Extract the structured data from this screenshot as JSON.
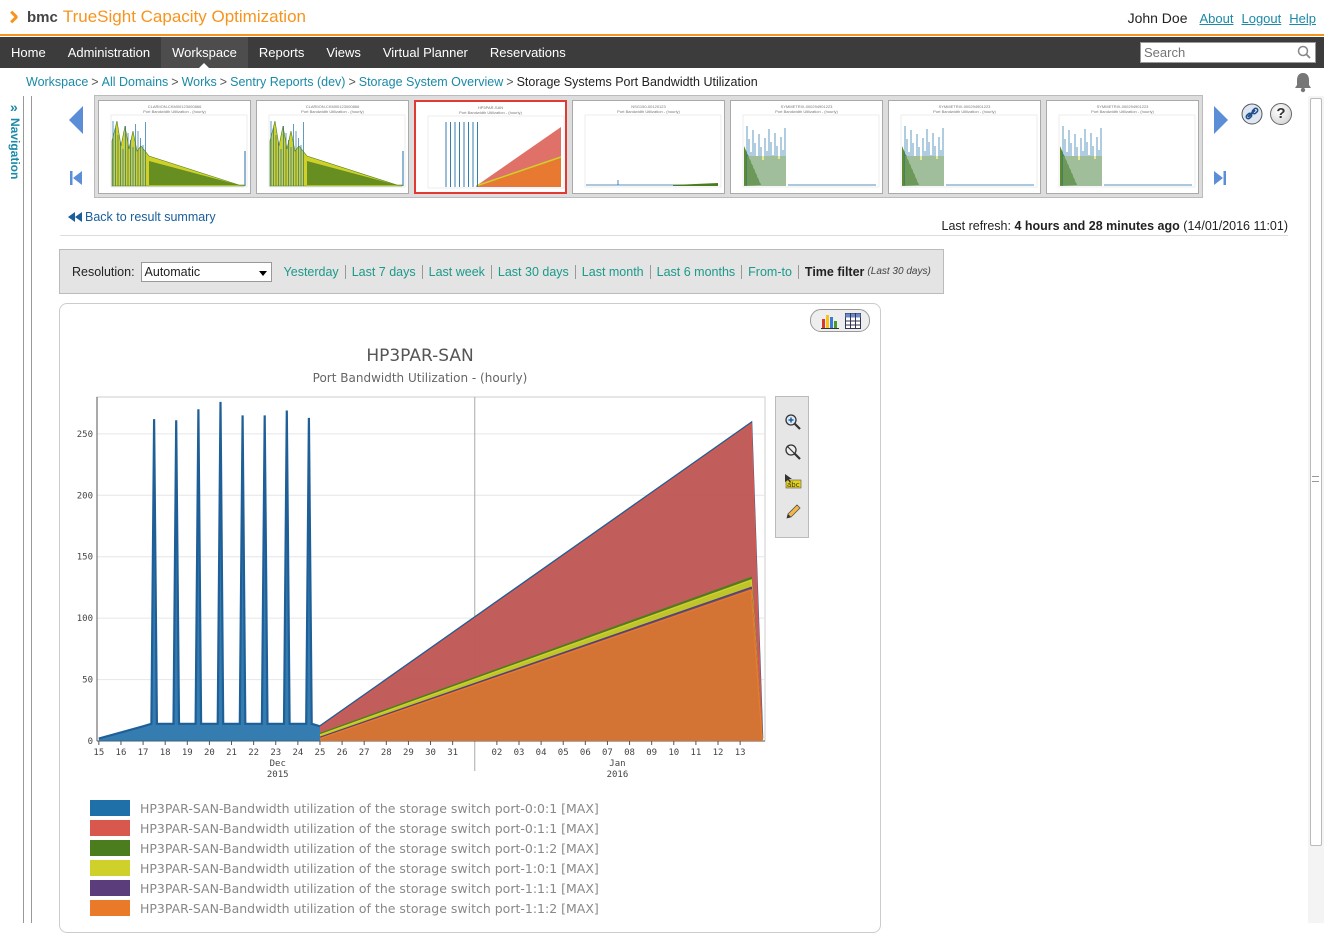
{
  "header": {
    "brand": "bmc",
    "product": "TrueSight Capacity Optimization",
    "user_name": "John Doe",
    "links": [
      "About",
      "Logout",
      "Help"
    ]
  },
  "menu": {
    "items": [
      "Home",
      "Administration",
      "Workspace",
      "Reports",
      "Views",
      "Virtual Planner",
      "Reservations"
    ],
    "active": "Workspace",
    "search_placeholder": "Search"
  },
  "breadcrumb": {
    "items": [
      "Workspace",
      "All Domains",
      "Works",
      "Sentry Reports (dev)",
      "Storage System Overview"
    ],
    "current": "Storage Systems Port Bandwidth Utilization"
  },
  "nav": {
    "label": "Navigation",
    "chevron": "»"
  },
  "carousel": {
    "selected_index": 2,
    "thumb_titles": [
      "CLARIION-CKM00123000866",
      "CLARIION-CKM00123000866",
      "HP3PAR-SAN",
      "NSG150-00120123",
      "SYMMETRIX-000294901223",
      "SYMMETRIX-000294901223",
      "SYMMETRIX-000294901223"
    ],
    "thumb_subtitle": "Port Bandwidth Utilization - (hourly)"
  },
  "back_link": "Back to result summary",
  "refresh": {
    "label": "Last refresh:",
    "ago": "4 hours and 28 minutes ago",
    "stamp": "(14/01/2016 11:01)"
  },
  "filter": {
    "resolution_label": "Resolution:",
    "resolution_value": "Automatic",
    "options": [
      "Yesterday",
      "Last 7 days",
      "Last week",
      "Last 30 days",
      "Last month",
      "Last 6 months",
      "From-to"
    ],
    "time_filter_label": "Time filter",
    "time_filter_value": "(Last 30 days)"
  },
  "colors": {
    "accent": "#f7941d",
    "link": "#1a8aa8",
    "selected_border": "#e03a32"
  },
  "chart_data": {
    "type": "area",
    "title": "HP3PAR-SAN",
    "subtitle": "Port Bandwidth Utilization - (hourly)",
    "ylim": [
      0,
      280
    ],
    "yticks": [
      0,
      50,
      100,
      150,
      200,
      250
    ],
    "x_day_ticks": [
      "15",
      "16",
      "17",
      "18",
      "19",
      "20",
      "21",
      "22",
      "23",
      "24",
      "25",
      "26",
      "27",
      "28",
      "29",
      "30",
      "31",
      "02",
      "03",
      "04",
      "05",
      "06",
      "07",
      "08",
      "09",
      "10",
      "11",
      "12",
      "13"
    ],
    "x_month_labels": [
      {
        "month": "Dec",
        "year": "2015"
      },
      {
        "month": "Jan",
        "year": "2016"
      }
    ],
    "grid": true,
    "legend_position": "bottom",
    "series": [
      {
        "name": "HP3PAR-SAN-Bandwidth utilization of the storage switch port-0:0:1 [MAX]",
        "color": "#1f6fa8",
        "points": [
          [
            "2015-12-15",
            2
          ],
          [
            "2015-12-16",
            7
          ],
          [
            "2015-12-17",
            12
          ],
          [
            "2015-12-17 12:00",
            262
          ],
          [
            "2015-12-18 12:00",
            261
          ],
          [
            "2015-12-19 12:00",
            270
          ],
          [
            "2015-12-20 12:00",
            276
          ],
          [
            "2015-12-21 12:00",
            265
          ],
          [
            "2015-12-22 12:00",
            265
          ],
          [
            "2015-12-23 12:00",
            269
          ],
          [
            "2015-12-24 12:00",
            263
          ],
          [
            "2015-12-25",
            12
          ],
          [
            "2016-01-13 12:00",
            259
          ],
          [
            "2016-01-14",
            2
          ]
        ]
      },
      {
        "name": "HP3PAR-SAN-Bandwidth utilization of the storage switch port-0:1:1 [MAX]",
        "color": "#d9584d",
        "points": [
          [
            "2015-12-25",
            11
          ],
          [
            "2016-01-13 12:00",
            258
          ],
          [
            "2016-01-14",
            1
          ]
        ]
      },
      {
        "name": "HP3PAR-SAN-Bandwidth utilization of the storage switch port-0:1:2 [MAX]",
        "color": "#4b7d1e",
        "points": [
          [
            "2015-12-25",
            6
          ],
          [
            "2016-01-13 12:00",
            133
          ],
          [
            "2016-01-14",
            1
          ]
        ]
      },
      {
        "name": "HP3PAR-SAN-Bandwidth utilization of the storage switch port-1:0:1 [MAX]",
        "color": "#cfd12a",
        "points": [
          [
            "2015-12-25",
            5
          ],
          [
            "2016-01-13 12:00",
            131
          ],
          [
            "2016-01-14",
            1
          ]
        ]
      },
      {
        "name": "HP3PAR-SAN-Bandwidth utilization of the storage switch port-1:1:1 [MAX]",
        "color": "#5a3d7a",
        "points": [
          [
            "2015-12-25",
            3
          ],
          [
            "2016-01-13 12:00",
            125
          ],
          [
            "2016-01-14",
            1
          ]
        ]
      },
      {
        "name": "HP3PAR-SAN-Bandwidth utilization of the storage switch port-1:1:2 [MAX]",
        "color": "#e87a2a",
        "points": [
          [
            "2015-12-25",
            2
          ],
          [
            "2016-01-13 12:00",
            123
          ],
          [
            "2016-01-14",
            1
          ]
        ]
      }
    ]
  }
}
